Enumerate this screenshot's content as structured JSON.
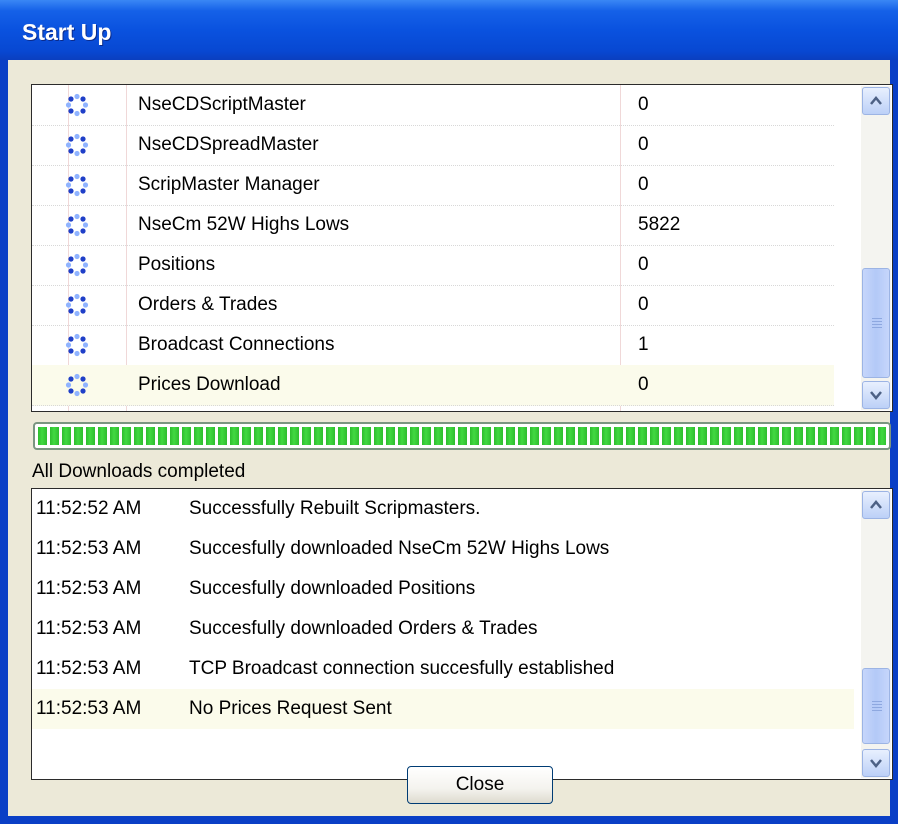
{
  "window": {
    "title": "Start Up"
  },
  "tasks": [
    {
      "name": "NseCDScriptMaster",
      "count": "0"
    },
    {
      "name": "NseCDSpreadMaster",
      "count": "0"
    },
    {
      "name": "ScripMaster Manager",
      "count": "0"
    },
    {
      "name": "NseCm 52W Highs Lows",
      "count": "5822"
    },
    {
      "name": "Positions",
      "count": "0"
    },
    {
      "name": "Orders & Trades",
      "count": "0"
    },
    {
      "name": "Broadcast Connections",
      "count": "1"
    },
    {
      "name": "Prices Download",
      "count": "0"
    }
  ],
  "task_icon": "loading-spinner-icon",
  "progress": {
    "percent": 100
  },
  "status": "All Downloads completed",
  "log": [
    {
      "time": "11:52:52 AM",
      "message": "Successfully Rebuilt Scripmasters."
    },
    {
      "time": "11:52:53 AM",
      "message": "Succesfully downloaded NseCm 52W Highs Lows"
    },
    {
      "time": "11:52:53 AM",
      "message": "Succesfully downloaded Positions"
    },
    {
      "time": "11:52:53 AM",
      "message": "Succesfully downloaded Orders & Trades"
    },
    {
      "time": "11:52:53 AM",
      "message": "TCP Broadcast connection succesfully established"
    },
    {
      "time": "11:52:53 AM",
      "message": "No Prices Request Sent"
    }
  ],
  "buttons": {
    "close": "Close"
  },
  "colors": {
    "titlebar": "#0a52df",
    "progress": "#2ebd2e",
    "face": "#ece9d8"
  }
}
